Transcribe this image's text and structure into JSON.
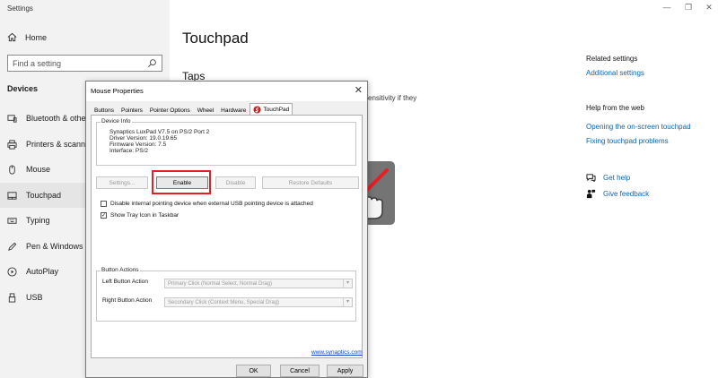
{
  "settings": {
    "title": "Settings",
    "home_label": "Home",
    "search_placeholder": "Find a setting",
    "section_label": "Devices",
    "nav": [
      {
        "label": "Bluetooth & other devices",
        "icon": "bluetooth-device-icon"
      },
      {
        "label": "Printers & scanners",
        "icon": "printer-icon"
      },
      {
        "label": "Mouse",
        "icon": "mouse-icon"
      },
      {
        "label": "Touchpad",
        "icon": "touchpad-icon"
      },
      {
        "label": "Typing",
        "icon": "keyboard-icon"
      },
      {
        "label": "Pen & Windows Ink",
        "icon": "pen-icon"
      },
      {
        "label": "AutoPlay",
        "icon": "autoplay-icon"
      },
      {
        "label": "USB",
        "icon": "usb-icon"
      }
    ],
    "active_nav": "Touchpad",
    "window_controls": {
      "minimize": "—",
      "restore": "❐",
      "close": "✕"
    }
  },
  "main": {
    "title": "Touchpad",
    "subtitle": "Taps",
    "fragment_text": "ensitivity if they"
  },
  "related": {
    "heading": "Related settings",
    "link": "Additional settings",
    "help_heading": "Help from the web",
    "help_links": [
      "Opening the on-screen touchpad",
      "Fixing touchpad problems"
    ],
    "get_help": "Get help",
    "give_feedback": "Give feedback"
  },
  "dialog": {
    "title": "Mouse Properties",
    "close": "✕",
    "tabs": [
      "Buttons",
      "Pointers",
      "Pointer Options",
      "Wheel",
      "Hardware",
      "TouchPad"
    ],
    "active_tab": "TouchPad",
    "device_info_label": "Device Info",
    "device_info": [
      "Synaptics LuxPad V7.5 on PS/2 Port 2",
      "Driver Version: 19.0.19.65",
      "Firmware Version: 7.5",
      "Interface: PS/2"
    ],
    "buttons": {
      "settings": "Settings...",
      "enable": "Enable",
      "disable": "Disable",
      "restore": "Restore Defaults"
    },
    "checkbox1": {
      "label": "Disable internal pointing device when external USB pointing device is attached",
      "checked": false
    },
    "checkbox2": {
      "label": "Show Tray Icon in Taskbar",
      "checked": true,
      "mark": "✓"
    },
    "button_actions_label": "Button Actions",
    "left_action_label": "Left Button Action",
    "left_action_value": "Primary Click (Normal Select, Normal Drag)",
    "right_action_label": "Right Button Action",
    "right_action_value": "Secondary Click (Context Menu, Special Drag)",
    "link": "www.synaptics.com",
    "ok": "OK",
    "cancel": "Cancel",
    "apply": "Apply"
  },
  "colors": {
    "highlight": "#e81e25",
    "link": "#0a64b4",
    "overlay": "#747474"
  }
}
